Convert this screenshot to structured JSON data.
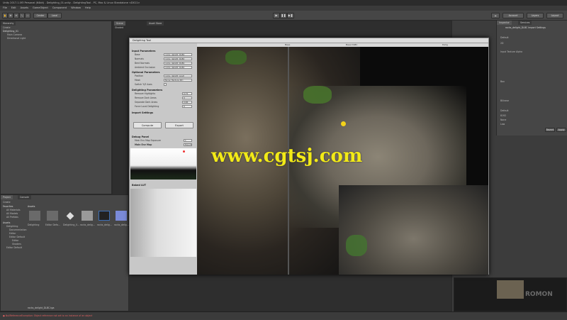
{
  "window_title": "Unity 2017.1.0f3 Personal (64bit) - Delighting_01.unity - DelightingTool - PC, Mac & Linux Standalone <DX11>",
  "menu": [
    "File",
    "Edit",
    "Assets",
    "GameObject",
    "Component",
    "Window",
    "Help"
  ],
  "toolbar": {
    "pivot": "Center",
    "space": "Local",
    "account": "Account",
    "layers": "Layers",
    "layout": "Layout"
  },
  "hierarchy": {
    "tab": "Hierarchy",
    "create": "Create",
    "scene": "Delighting_01",
    "items": [
      "Main Camera",
      "Directional Light"
    ]
  },
  "scene_tabs": [
    "Scene",
    "Asset Store"
  ],
  "scene_mode": "Shaded",
  "inspector": {
    "tab": "Inspector",
    "services": "Services",
    "title": "rocks_delight_DLBC Import Settings",
    "fields": [
      "Default",
      "2D",
      "Input Texture Alpha",
      "Box",
      "Bilinear",
      "Default",
      "8192",
      "None",
      "Low"
    ],
    "buttons": [
      "Revert",
      "Apply"
    ]
  },
  "tool": {
    "title": "Delighting Tool",
    "sections": {
      "input": "Input Parameters",
      "optional": "Optional Parameters",
      "delight": "Delighting Parameters",
      "import": "Import Settings",
      "debug": "Debug Panel"
    },
    "input_fields": [
      {
        "label": "Base",
        "value": "rocks_delight_DLBC"
      },
      {
        "label": "Normals",
        "value": "rocks_delight_DLBC"
      },
      {
        "label": "Bent Normals",
        "value": "rocks_delight_DLBC"
      },
      {
        "label": "Ambient Occlusion",
        "value": "rocks_delight_DLBC"
      }
    ],
    "optional_fields": [
      {
        "label": "Position",
        "value": "rocks_delight_posit"
      },
      {
        "label": "Mask",
        "value": "None (Texture 2D)"
      },
      {
        "label": "Switch Y/Z Axes",
        "value": ""
      }
    ],
    "delight_fields": [
      {
        "label": "Remove Highlights",
        "value": "0.75"
      },
      {
        "label": "Remove Dark Areas",
        "value": "0"
      },
      {
        "label": "Separate Dark Areas",
        "value": "0.66"
      },
      {
        "label": "Force Local Delighting",
        "value": "0"
      }
    ],
    "compute": "Compute",
    "export": "Export",
    "debug_labels": [
      "Main Env Map Exposure",
      "Main Env Map"
    ],
    "debug_value": "1",
    "debug_button": "Export",
    "baked_lut": "Baked LUT",
    "viewport_labels": [
      "Base",
      "Base DLBC",
      "Delig"
    ]
  },
  "project": {
    "tabs": [
      "Project",
      "Console"
    ],
    "create": "Create",
    "favorites": [
      "Favorites",
      "All Materials",
      "All Models",
      "All Prefabs"
    ],
    "folders": [
      "Assets",
      "Delighting",
      "Documentation",
      "Editor",
      "Editor Default",
      "Editor",
      "Shaders",
      "Editor Default"
    ],
    "breadcrumb": "Assets",
    "assets": [
      "Delighting",
      "Editor Defa...",
      "Delighting_0...",
      "rocks_delig...",
      "rocks_delig...",
      "rocks_delig..."
    ]
  },
  "selected_file": "rocks_delight_DLBC.tga",
  "status_error": "NullReferenceException: Object reference not set to an instance of an object",
  "watermark": "www.cgtsj.com",
  "preview_brand": "ROMON",
  "colors": {
    "accent": "#3d6fb6",
    "watermark": "#f2ea17"
  }
}
